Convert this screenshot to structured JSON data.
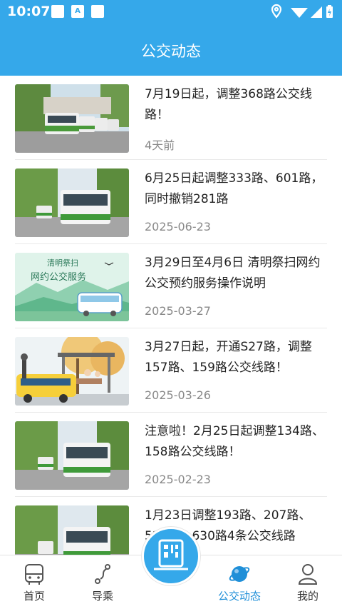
{
  "status_bar": {
    "time": "10:07",
    "notif_letter": "A"
  },
  "header": {
    "title": "公交动态"
  },
  "news": [
    {
      "title": "7月19日起，调整368路公交线路！",
      "date": "4天前",
      "thumb": "bus-street-photo"
    },
    {
      "title": "6月25日起调整333路、601路，同时撤销281路",
      "date": "2025-06-23",
      "thumb": "bus-street-photo"
    },
    {
      "title": " 3月29日至4月6日 清明祭扫网约公交预约服务操作说明",
      "date": "2025-03-27",
      "thumb": "qingming-illustration",
      "thumb_text": {
        "line1": "清明祭扫",
        "line2": "网约公交服务"
      }
    },
    {
      "title": "3月27日起，开通S27路，调整157路、159路公交线路！",
      "date": "2025-03-26",
      "thumb": "bus-stop-illustration"
    },
    {
      "title": " 注意啦！2月25日起调整134路、158路公交线路！",
      "date": "2025-02-23",
      "thumb": "bus-street-photo"
    },
    {
      "title": "1月23日调整193路、207路、526路、630路4条公交线路",
      "date": "",
      "thumb": "bus-street-photo"
    }
  ],
  "tabbar": {
    "tabs": [
      {
        "label": "首页",
        "icon": "bus-icon"
      },
      {
        "label": "导乘",
        "icon": "route-icon"
      },
      {
        "label": "公交动态",
        "icon": "planet-icon",
        "active": true
      },
      {
        "label": "我的",
        "icon": "user-icon"
      }
    ],
    "center_icon": "qr-scan-icon"
  },
  "colors": {
    "primary": "#35a8ea",
    "active_tab": "#1f8fd8",
    "title": "#222222",
    "date": "#888888"
  }
}
